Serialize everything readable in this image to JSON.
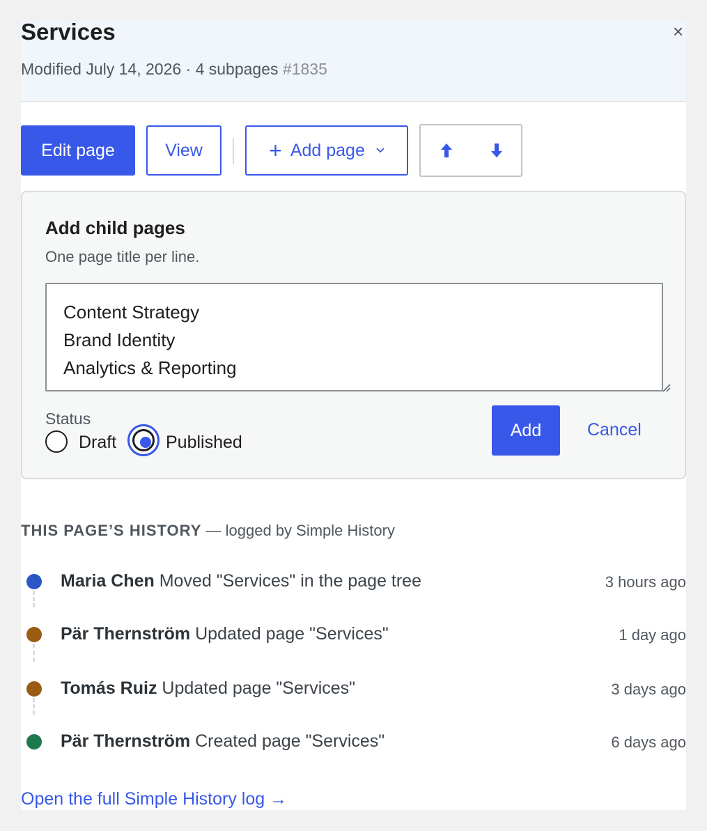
{
  "header": {
    "title": "Services",
    "modified": "Modified July 14, 2026 · 4 subpages",
    "page_id": "#1835",
    "close_label": "×"
  },
  "toolbar": {
    "edit_label": "Edit page",
    "view_label": "View",
    "add_label": "Add page",
    "add_plus": "+"
  },
  "child_pages": {
    "title": "Add child pages",
    "help": "One page title per line.",
    "titles_value": "Content Strategy\nBrand Identity\nAnalytics & Reporting",
    "status_label": "Status",
    "status_options": [
      "Draft",
      "Published"
    ],
    "status_selected": "Published",
    "add_label": "Add",
    "cancel_label": "Cancel"
  },
  "history": {
    "heading": "This page’s history",
    "subheading": " — logged by Simple History",
    "events": [
      {
        "user": "Maria Chen",
        "action": " Moved \"Services\" in the page tree",
        "time": "3 hours ago",
        "color": "#2a56c6"
      },
      {
        "user": "Pär Thernström",
        "action": " Updated page \"Services\"",
        "time": "1 day ago",
        "color": "#9a5b13"
      },
      {
        "user": "Tomás Ruiz",
        "action": " Updated page \"Services\"",
        "time": "3 days ago",
        "color": "#9a5b13"
      },
      {
        "user": "Pär Thernström",
        "action": " Created page \"Services\"",
        "time": "6 days ago",
        "color": "#1a7a4c"
      }
    ],
    "full_log_label": "Open the full Simple History log →"
  },
  "colors": {
    "accent": "#3858e9",
    "header_bg": "#f0f6fc"
  }
}
